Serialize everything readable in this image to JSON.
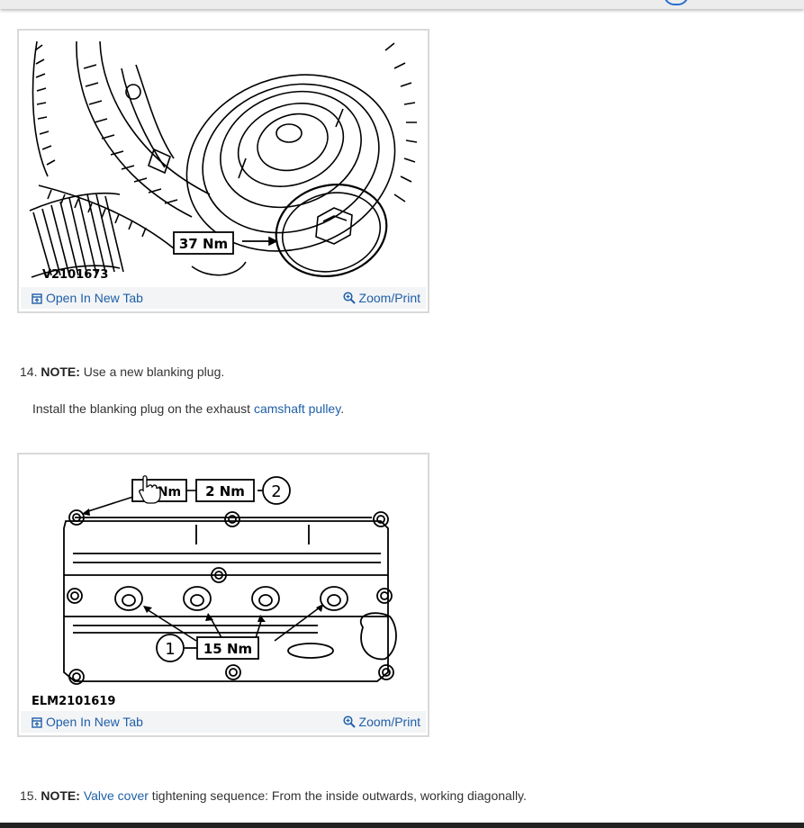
{
  "figures": [
    {
      "code": "V2101673",
      "callouts": [
        "37 Nm"
      ],
      "open_label": "Open In New Tab",
      "zoom_label": "Zoom/Print"
    },
    {
      "code": "ELM2101619",
      "callouts": [
        "Nm",
        "2 Nm",
        "2",
        "1",
        "15 Nm"
      ],
      "open_label": "Open In New Tab",
      "zoom_label": "Zoom/Print"
    }
  ],
  "steps": [
    {
      "number": "14.",
      "note_label": "NOTE:",
      "note_text": " Use a new blanking plug.",
      "instruction_prefix": "Install the blanking plug on the exhaust ",
      "instruction_link": "camshaft pulley",
      "instruction_suffix": "."
    },
    {
      "number": "15.",
      "note_label": "NOTE:",
      "note_link": "Valve cover",
      "note_text": " tightening sequence: From the inside outwards, working diagonally."
    }
  ],
  "icons": {
    "open": "open-new-tab-icon",
    "zoom": "magnifier-plus-icon"
  },
  "colors": {
    "link": "#1e5fa8",
    "bar_bg": "#f3f4f6",
    "border": "#d9d9d9"
  }
}
